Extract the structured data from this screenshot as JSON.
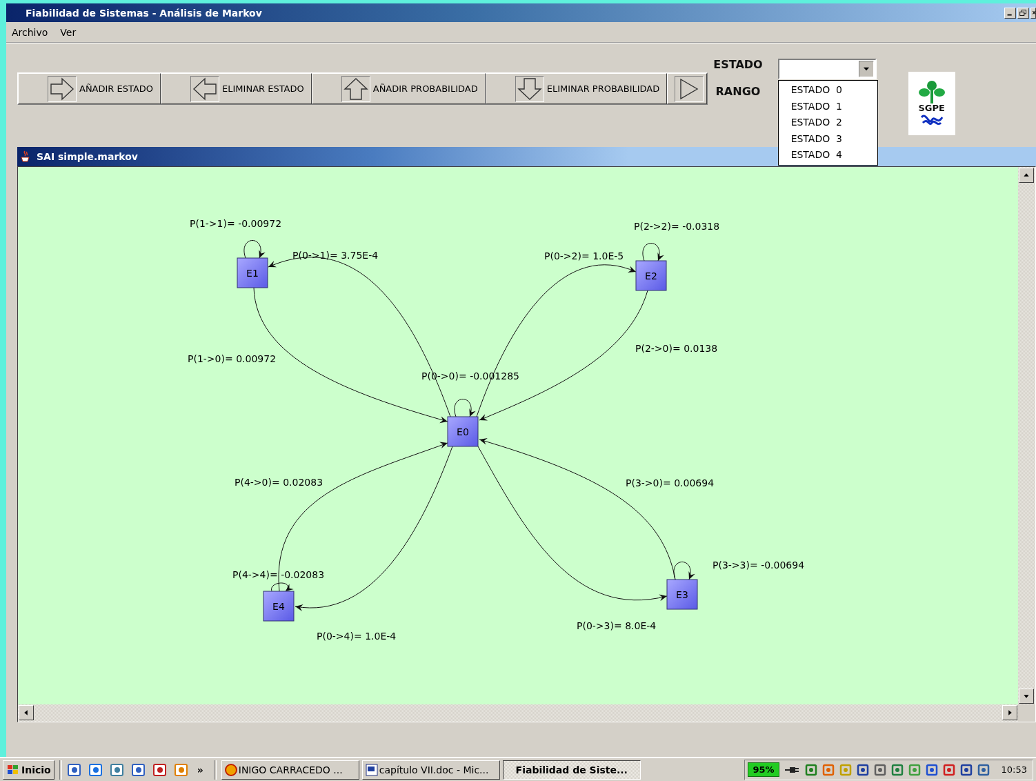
{
  "window": {
    "title": "Fiabilidad de Sistemas - Análisis de Markov"
  },
  "menu": [
    "Archivo",
    "Ver"
  ],
  "toolbar": [
    {
      "label": "AÑADIR ESTADO",
      "kind": "right"
    },
    {
      "label": "ELIMINAR ESTADO",
      "kind": "left"
    },
    {
      "label": "AÑADIR PROBABILIDAD",
      "kind": "up"
    },
    {
      "label": "ELIMINAR PROBABILIDAD",
      "kind": "down"
    },
    {
      "kind": "play"
    }
  ],
  "estado": {
    "label": "ESTADO",
    "expanded": true,
    "options": [
      "ESTADO  0",
      "ESTADO  1",
      "ESTADO  2",
      "ESTADO  3",
      "ESTADO  4"
    ]
  },
  "rango": {
    "label": "RANGO"
  },
  "logo": {
    "text": "SGPE"
  },
  "document": {
    "title": "SAI simple.markov",
    "states": [
      {
        "label": "E0"
      },
      {
        "label": "E1"
      },
      {
        "label": "E2"
      },
      {
        "label": "E3"
      },
      {
        "label": "E4"
      }
    ],
    "transitions": [
      {
        "label": "P(1->1)= -0.00972"
      },
      {
        "label": "P(2->2)= -0.0318"
      },
      {
        "label": "P(0->1)= 3.75E-4"
      },
      {
        "label": "P(0->2)= 1.0E-5"
      },
      {
        "label": "P(2->0)= 0.0138"
      },
      {
        "label": "P(1->0)= 0.00972"
      },
      {
        "label": "P(0->0)= -0.001285"
      },
      {
        "label": "P(4->0)= 0.02083"
      },
      {
        "label": "P(3->0)= 0.00694"
      },
      {
        "label": "P(3->3)= -0.00694"
      },
      {
        "label": "P(4->4)= -0.02083"
      },
      {
        "label": "P(0->3)= 8.0E-4"
      },
      {
        "label": "P(0->4)= 1.0E-4"
      }
    ]
  },
  "taskbar": {
    "start": "Inicio",
    "more": "»",
    "tasks": [
      {
        "label": "INIGO CARRACEDO ...",
        "kind": "app",
        "selected": false
      },
      {
        "label": "capítulo VII.doc - Mic...",
        "kind": "word",
        "selected": false
      },
      {
        "label": "Fiabilidad de Siste...",
        "kind": "java",
        "selected": true
      }
    ],
    "battery": "95%",
    "clock": "10:53"
  }
}
